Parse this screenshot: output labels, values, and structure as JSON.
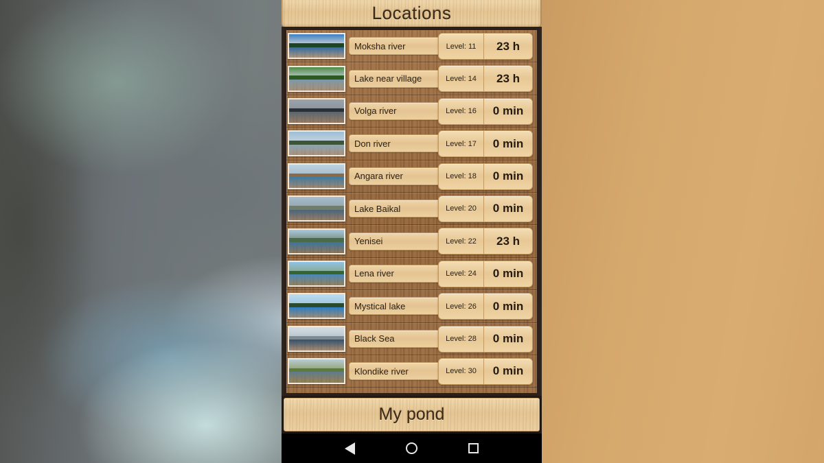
{
  "window": {
    "title": "Locations"
  },
  "header": {
    "title": "Locations"
  },
  "locations": [
    {
      "name": "Moksha river",
      "level_label": "Level: 11",
      "level": 11,
      "time": "23 h",
      "thumb": {
        "sky": "#3e7ec4",
        "land": "#1d4426",
        "water": "#2f6ba6",
        "shore": "#cfd6d2"
      }
    },
    {
      "name": "Lake near village",
      "level_label": "Level: 14",
      "level": 14,
      "time": "23 h",
      "thumb": {
        "sky": "#4e8b46",
        "land": "#2c5a22",
        "water": "#7c99a8",
        "shore": "#b9c7cc"
      }
    },
    {
      "name": "Volga river",
      "level_label": "Level: 16",
      "level": 16,
      "time": "0 min",
      "thumb": {
        "sky": "#9ba4ad",
        "land": "#2b3036",
        "water": "#5b6671",
        "shore": "#8a929b"
      }
    },
    {
      "name": "Don river",
      "level_label": "Level: 17",
      "level": 17,
      "time": "0 min",
      "thumb": {
        "sky": "#9dbdd6",
        "land": "#3b5536",
        "water": "#8aa5b6",
        "shore": "#c7d5dd"
      }
    },
    {
      "name": "Angara river",
      "level_label": "Level: 18",
      "level": 18,
      "time": "0 min",
      "thumb": {
        "sky": "#bcd3e2",
        "land": "#8a6a48",
        "water": "#3f7ba1",
        "shore": "#a9bccb"
      }
    },
    {
      "name": "Lake Baikal",
      "level_label": "Level: 20",
      "level": 20,
      "time": "0 min",
      "thumb": {
        "sky": "#a8bdcd",
        "land": "#6f7d6a",
        "water": "#49657b",
        "shore": "#93a6ae"
      }
    },
    {
      "name": "Yenisei",
      "level_label": "Level: 22",
      "level": 22,
      "time": "23 h",
      "thumb": {
        "sky": "#a9c8e0",
        "land": "#4a6b4a",
        "water": "#3d73a0",
        "shore": "#7a8f7e"
      }
    },
    {
      "name": "Lena river",
      "level_label": "Level: 24",
      "level": 24,
      "time": "0 min",
      "thumb": {
        "sky": "#8fc1e4",
        "land": "#35662f",
        "water": "#4a88b8",
        "shore": "#88a98a"
      }
    },
    {
      "name": "Mystical lake",
      "level_label": "Level: 26",
      "level": 26,
      "time": "0 min",
      "thumb": {
        "sky": "#bcdcf0",
        "land": "#2c4a2c",
        "water": "#2b7ec4",
        "shore": "#9fc6de"
      }
    },
    {
      "name": "Black Sea",
      "level_label": "Level: 28",
      "level": 28,
      "time": "0 min",
      "thumb": {
        "sky": "#d4dde3",
        "land": "#7d8c93",
        "water": "#35506b",
        "shore": "#b9c6ce"
      }
    },
    {
      "name": "Klondike river",
      "level_label": "Level: 30",
      "level": 30,
      "time": "0 min",
      "thumb": {
        "sky": "#b9cbd5",
        "land": "#5f7a3e",
        "water": "#5f7b8c",
        "shore": "#8fa36c"
      }
    }
  ],
  "footer": {
    "pond_label": "My pond"
  },
  "navbar": {
    "back_label": "Back",
    "home_label": "Home",
    "recents_label": "Recents"
  },
  "colors": {
    "wood_light": "#e5c593",
    "wood_dark": "#9d6f45",
    "frame_dark": "#2b211a",
    "text_dark": "#2a2015",
    "navbar_bg": "#000000",
    "backdrop_tan": "#d5a86c"
  }
}
